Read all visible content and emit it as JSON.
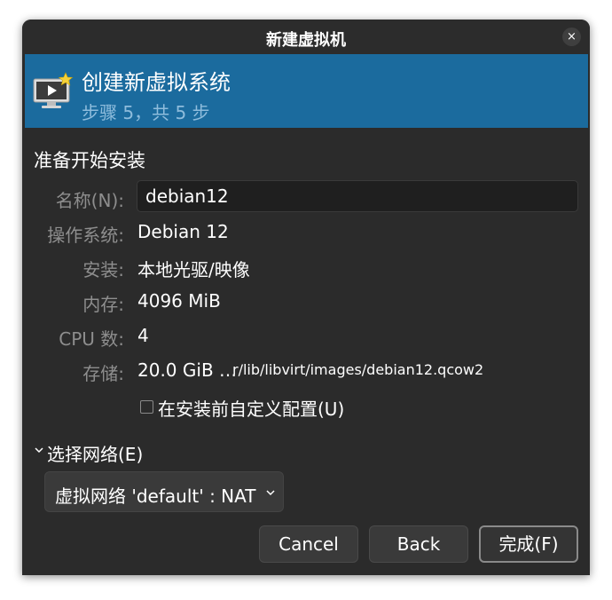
{
  "window": {
    "title": "新建虚拟机",
    "close_glyph": "×"
  },
  "banner": {
    "title": "创建新虚拟系统",
    "subtitle": "步骤 5，共 5 步",
    "icon": "monitor-with-star-icon"
  },
  "section_title": "准备开始安装",
  "fields": {
    "name_label": "名称(N):",
    "name_value": "debian12",
    "os_label": "操作系统:",
    "os_value": "Debian 12",
    "install_label": "安装:",
    "install_value": "本地光驱/映像",
    "memory_label": "内存:",
    "memory_value": "4096 MiB",
    "cpu_label": "CPU 数:",
    "cpu_value": "4",
    "storage_label": "存储:",
    "storage_size": "20.0 GiB …",
    "storage_path": "r/lib/libvirt/images/debian12.qcow2"
  },
  "customize_checkbox": {
    "label": "在安装前自定义配置(U)",
    "checked": false
  },
  "network": {
    "expander_label": "选择网络(E)",
    "expanded": true,
    "selected": "虚拟网络 'default' : NAT"
  },
  "buttons": {
    "cancel": "Cancel",
    "back": "Back",
    "finish": "完成(F)"
  },
  "colors": {
    "banner_bg": "#1b6b9e",
    "banner_subtitle": "#8ebcdc",
    "window_bg": "#2b2b2b",
    "label_gray": "#8e8e8e"
  }
}
